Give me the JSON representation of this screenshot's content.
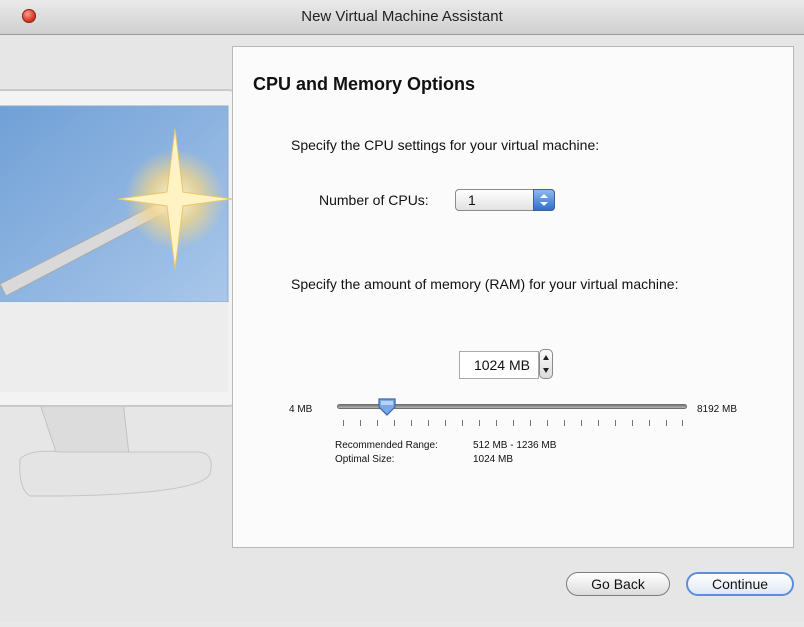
{
  "window": {
    "title": "New Virtual Machine Assistant"
  },
  "panel": {
    "heading": "CPU and Memory Options",
    "cpu_prompt": "Specify the CPU settings for your virtual machine:",
    "cpu_label": "Number of CPUs:",
    "cpu_value": "1",
    "memory_prompt": "Specify the amount of memory (RAM) for your virtual machine:",
    "memory_value": "1024 MB",
    "slider": {
      "min_label": "4 MB",
      "max_label": "8192 MB",
      "value_mb": 1024
    },
    "recommended_label": "Recommended Range:",
    "recommended_value": "512 MB - 1236 MB",
    "optimal_label": "Optimal Size:",
    "optimal_value": "1024 MB"
  },
  "buttons": {
    "back": "Go Back",
    "continue": "Continue"
  },
  "colors": {
    "accent": "#5b8fdc",
    "close": "#d2331f"
  }
}
